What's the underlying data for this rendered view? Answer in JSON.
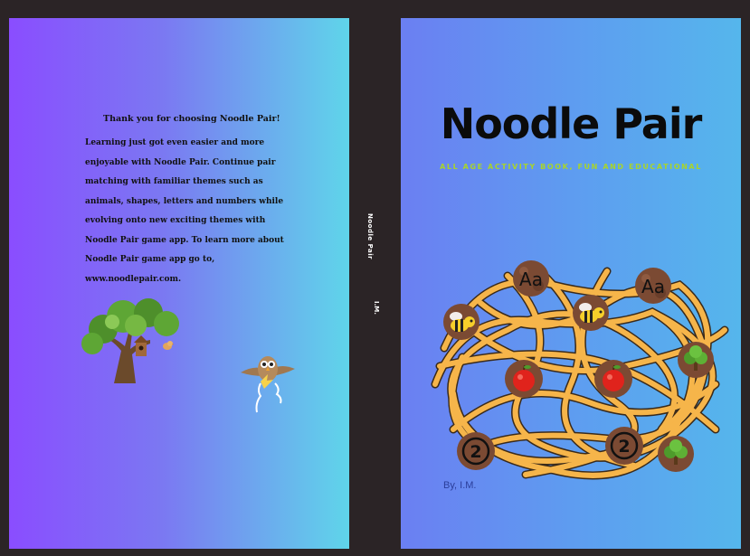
{
  "back_cover": {
    "heading": "Thank you for choosing Noodle Pair!",
    "body": "Learning just got even easier and more enjoyable with Noodle Pair. Continue pair matching with familiar themes such as animals, shapes, letters and numbers while evolving onto new exciting themes with Noodle Pair game app. To learn more about Noodle Pair game app go to, www.noodlepair.com."
  },
  "spine": {
    "title": "Noodle Pair",
    "author": "I.M."
  },
  "front_cover": {
    "title": "Noodle Pair",
    "subtitle": "ALL AGE ACTIVITY BOOK, FUN AND EDUCATIONAL",
    "byline": "By, I.M.",
    "meatball_labels": {
      "letter": "Aa",
      "number": "2"
    }
  },
  "icons": [
    "tree-with-birdhouse-icon",
    "small-bird-icon",
    "flying-owl-icon",
    "bee-icon",
    "apple-icon",
    "tree-icon",
    "meatball-icon",
    "noodle-tangle-icon"
  ],
  "colors": {
    "back_gradient_start": "#8a4dff",
    "back_gradient_end": "#5fd5ea",
    "front_gradient_start": "#6b7ff2",
    "front_gradient_end": "#55b6ec",
    "spine": "#2b2426",
    "noodle": "#f6b54a",
    "meatball": "#7b4a33",
    "subtitle": "#a8d42b"
  }
}
